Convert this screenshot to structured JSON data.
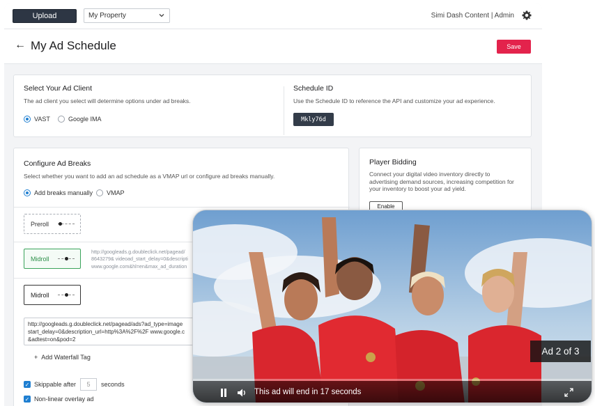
{
  "topbar": {
    "upload_label": "Upload",
    "property_select": "My Property",
    "user_text": "Simi Dash Content | Admin",
    "icons": [
      "chevron-down-icon",
      "gear-icon"
    ]
  },
  "header": {
    "title": "My Ad Schedule",
    "save_label": "Save",
    "icons": [
      "back-arrow-icon"
    ]
  },
  "ad_client": {
    "title": "Select Your Ad Client",
    "description": "The ad client you select will determine options under ad breaks.",
    "options": [
      "VAST",
      "Google IMA"
    ],
    "selected": "VAST"
  },
  "schedule": {
    "title": "Schedule ID",
    "description": "Use the Schedule ID to reference the API and customize your ad experience.",
    "id": "Mkly76d"
  },
  "breaks": {
    "title": "Configure Ad Breaks",
    "description": "Select whether you want to add an ad schedule as a VMAP url or configure ad breaks manually.",
    "options": [
      "Add breaks manually",
      "VMAP"
    ],
    "selected": "Add breaks manually",
    "items": [
      {
        "label": "Preroll",
        "style": "dashed",
        "knob": 0.1
      },
      {
        "label": "Midroll",
        "style": "green",
        "knob": 0.5
      },
      {
        "label": "Midroll",
        "style": "solid",
        "knob": 0.5
      }
    ],
    "midroll_url_lines": [
      "http://googleads.g.doubleclick.net/pagead/",
      "8643279& videoad_start_delay=0&descripti",
      "www.google.com&hl=en&max_ad_duration"
    ],
    "url_lines": [
      "http://googleads.g.doubleclick.net/pagead/ads?ad_type=image",
      "start_delay=0&description_url=http%3A%2F%2F www.google.c",
      "&adtest=on&pod=2"
    ],
    "add_waterfall": "Add Waterfall Tag",
    "skippable_label": "Skippable after",
    "skippable_value": "5",
    "seconds_label": "seconds",
    "nonlinear_label": "Non-linear overlay ad"
  },
  "bidding": {
    "title": "Player Bidding",
    "description_lines": [
      "Connect your digital video inventory directly to",
      "advertising demand sources, increasing competition for",
      "your inventory to boost your ad yield."
    ],
    "enable_label": "Enable"
  },
  "video": {
    "ad_badge": "Ad 2 of 3",
    "message": "This ad will end in 17 seconds",
    "progress": 0.0,
    "icons": [
      "pause-icon",
      "volume-icon",
      "fullscreen-icon"
    ]
  }
}
